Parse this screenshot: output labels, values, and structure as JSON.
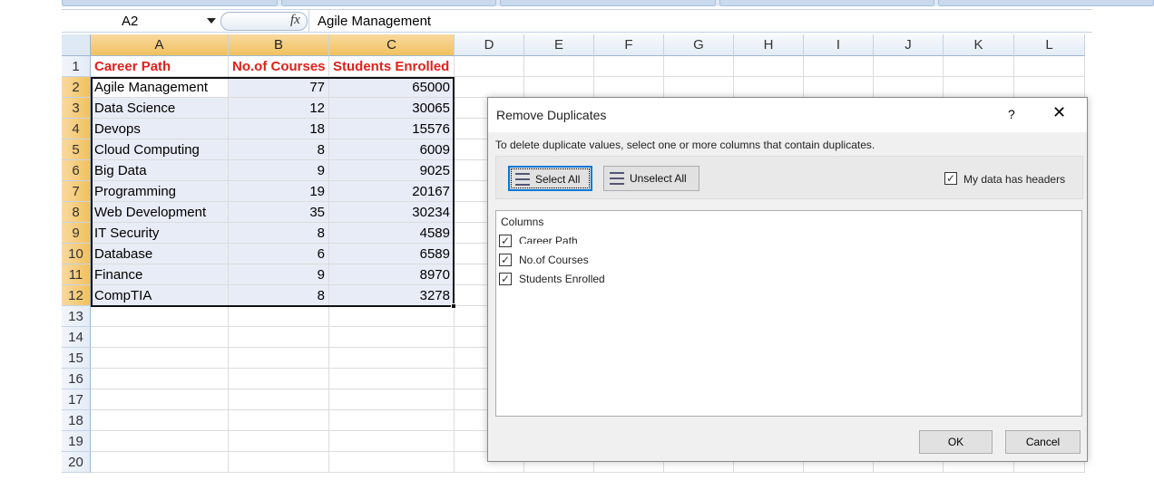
{
  "formula_bar": {
    "name_box": "A2",
    "fx": "fx",
    "value": "Agile Management"
  },
  "columns": [
    "A",
    "B",
    "C",
    "D",
    "E",
    "F",
    "G",
    "H",
    "I",
    "J",
    "K",
    "L"
  ],
  "rows": [
    "1",
    "2",
    "3",
    "4",
    "5",
    "6",
    "7",
    "8",
    "9",
    "10",
    "11",
    "12",
    "13",
    "14",
    "15",
    "16",
    "17",
    "18",
    "19",
    "20"
  ],
  "headers": [
    "Career Path",
    "No.of Courses",
    "Students Enrolled"
  ],
  "data": [
    [
      "Agile Management",
      "77",
      "65000"
    ],
    [
      "Data Science",
      "12",
      "30065"
    ],
    [
      "Devops",
      "18",
      "15576"
    ],
    [
      "Cloud Computing",
      "8",
      "6009"
    ],
    [
      "Big Data",
      "9",
      "9025"
    ],
    [
      "Programming",
      "19",
      "20167"
    ],
    [
      "Web Development",
      "35",
      "30234"
    ],
    [
      "IT Security",
      "8",
      "4589"
    ],
    [
      "Database",
      "6",
      "6589"
    ],
    [
      "Finance",
      "9",
      "8970"
    ],
    [
      "CompTIA",
      "8",
      "3278"
    ]
  ],
  "dialog": {
    "title": "Remove Duplicates",
    "help": "?",
    "close": "✕",
    "description": "To delete duplicate values, select one or more columns that contain duplicates.",
    "select_all": "Select All",
    "unselect_all": "Unselect All",
    "headers_checkbox": "My data has headers",
    "headers_checked": true,
    "columns_label": "Columns",
    "column_items": [
      {
        "label": "Career Path",
        "checked": true
      },
      {
        "label": "No.of Courses",
        "checked": true
      },
      {
        "label": "Students Enrolled",
        "checked": true
      }
    ],
    "ok": "OK",
    "cancel": "Cancel"
  },
  "colors": {
    "header_text": "#e0201a",
    "selection_fill": "#e8ecf6",
    "selected_header": "#f1c15f",
    "accent": "#0078d7"
  }
}
